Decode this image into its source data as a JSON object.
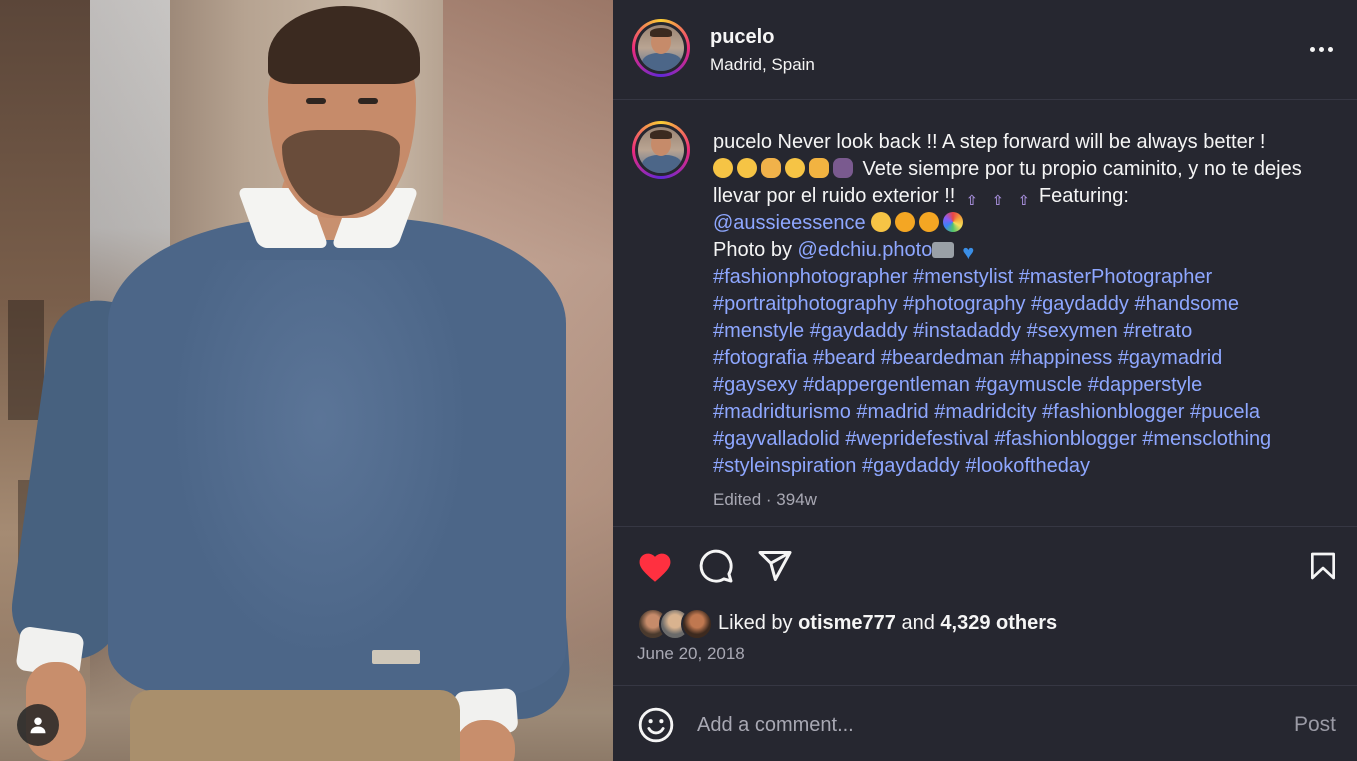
{
  "post": {
    "username": "pucelo",
    "location": "Madrid, Spain",
    "caption": {
      "username": "pucelo",
      "line1_text": " Never look back !! A step forward will be always better !",
      "line2_text": " Vete siempre por tu propio caminito, y no te dejes llevar por el ruido exterior !! ",
      "featuring_label": "Featuring:",
      "mention_1": "@aussieessence",
      "photo_by_label": "Photo by ",
      "mention_2": "@edchiu.photo",
      "hashtags": [
        "#fashionphotographer",
        "#menstylist",
        "#masterPhotographer",
        "#portraitphotography",
        "#photography",
        "#gaydaddy",
        "#handsome",
        "#menstyle",
        "#gaydaddy",
        "#instadaddy",
        "#sexymen",
        "#retrato",
        "#fotografia",
        "#beard",
        "#beardedman",
        "#happiness",
        "#gaymadrid",
        "#gaysexy",
        "#dappergentleman",
        "#gaymuscle",
        "#dapperstyle",
        "#madridturismo",
        "#madrid",
        "#madridcity",
        "#fashionblogger",
        "#pucela",
        "#gayvalladolid",
        "#wepridefestival",
        "#fashionblogger",
        "#mensclothing",
        "#styleinspiration",
        "#gaydaddy",
        "#lookoftheday"
      ]
    },
    "edited_label": "Edited · 394w",
    "liked_by_prefix": "Liked by ",
    "liked_by_user": "otisme777",
    "liked_by_and": " and ",
    "liked_by_others": "4,329 others",
    "date": "June 20, 2018",
    "liked": true
  },
  "comment": {
    "placeholder": "Add a comment...",
    "post_label": "Post"
  },
  "icons": {
    "like": "heart-icon",
    "comment": "comment-icon",
    "share": "share-icon",
    "save": "bookmark-icon",
    "more": "more-icon",
    "emoji": "emoji-icon",
    "user": "user-icon"
  },
  "colors": {
    "panel_bg": "#262730",
    "link": "#8ea7ff",
    "like_red": "#ff3040",
    "muted": "#a8a8b3"
  }
}
